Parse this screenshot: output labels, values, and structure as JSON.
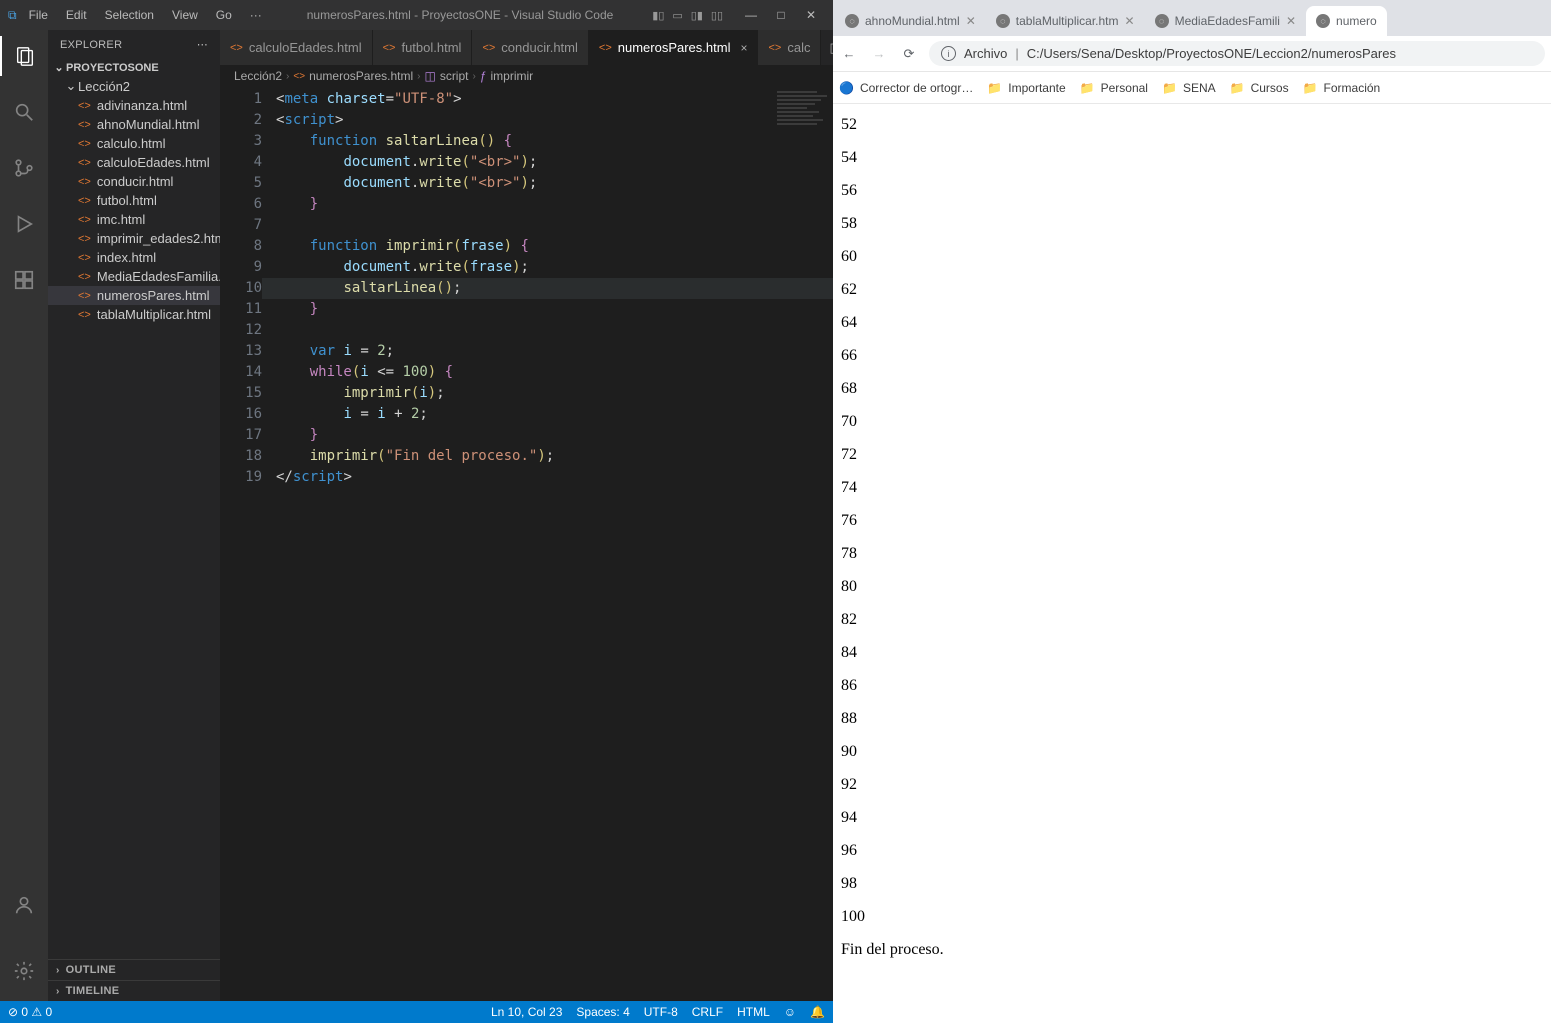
{
  "vscode": {
    "menus": [
      "File",
      "Edit",
      "Selection",
      "View",
      "Go",
      "···"
    ],
    "title": "numerosPares.html - ProyectosONE - Visual Studio Code",
    "explorer": {
      "title": "EXPLORER",
      "project": "PROYECTOSONE",
      "folder": "Lección2",
      "files": [
        "adivinanza.html",
        "ahnoMundial.html",
        "calculo.html",
        "calculoEdades.html",
        "conducir.html",
        "futbol.html",
        "imc.html",
        "imprimir_edades2.html",
        "index.html",
        "MediaEdadesFamilia.html",
        "numerosPares.html",
        "tablaMultiplicar.html"
      ],
      "activeFile": "numerosPares.html",
      "panels": [
        "OUTLINE",
        "TIMELINE"
      ]
    },
    "tabs": [
      {
        "name": "calculoEdades.html",
        "active": false
      },
      {
        "name": "futbol.html",
        "active": false
      },
      {
        "name": "conducir.html",
        "active": false
      },
      {
        "name": "numerosPares.html",
        "active": true,
        "close": "×"
      },
      {
        "name": "calc",
        "active": false,
        "truncated": true
      }
    ],
    "breadcrumbs": [
      "Lección2",
      "numerosPares.html",
      "script",
      "imprimir"
    ],
    "code": {
      "lines": [
        {
          "n": "1",
          "html": "<span class=\"op\">&lt;</span><span class=\"kw-struct\">meta</span> <span class=\"attr\">charset</span><span class=\"op\">=</span><span class=\"str\">\"UTF-8\"</span><span class=\"op\">&gt;</span>"
        },
        {
          "n": "2",
          "html": "<span class=\"op\">&lt;</span><span class=\"kw-struct\">script</span><span class=\"op\">&gt;</span>"
        },
        {
          "n": "3",
          "html": "    <span class=\"kw-struct\">function</span> <span class=\"fn\">saltarLinea</span><span class=\"brkt\">()</span> <span class=\"brkt2\">{</span>"
        },
        {
          "n": "4",
          "html": "        <span class=\"var\">document</span><span class=\"op\">.</span><span class=\"fn\">write</span><span class=\"brkt\">(</span><span class=\"str\">\"&lt;br&gt;\"</span><span class=\"brkt\">)</span><span class=\"op\">;</span>"
        },
        {
          "n": "5",
          "html": "        <span class=\"var\">document</span><span class=\"op\">.</span><span class=\"fn\">write</span><span class=\"brkt\">(</span><span class=\"str\">\"&lt;br&gt;\"</span><span class=\"brkt\">)</span><span class=\"op\">;</span>"
        },
        {
          "n": "6",
          "html": "    <span class=\"brkt2\">}</span>"
        },
        {
          "n": "7",
          "html": ""
        },
        {
          "n": "8",
          "html": "    <span class=\"kw-struct\">function</span> <span class=\"fn\">imprimir</span><span class=\"brkt\">(</span><span class=\"var\">frase</span><span class=\"brkt\">)</span> <span class=\"brkt2\">{</span>"
        },
        {
          "n": "9",
          "html": "        <span class=\"var\">document</span><span class=\"op\">.</span><span class=\"fn\">write</span><span class=\"brkt\">(</span><span class=\"var\">frase</span><span class=\"brkt\">)</span><span class=\"op\">;</span>"
        },
        {
          "n": "10",
          "html": "        <span class=\"fn\">saltarLinea</span><span class=\"brkt\">()</span><span class=\"op\">;</span>",
          "hl": true
        },
        {
          "n": "11",
          "html": "    <span class=\"brkt2\">}</span>"
        },
        {
          "n": "12",
          "html": ""
        },
        {
          "n": "13",
          "html": "    <span class=\"kw-struct\">var</span> <span class=\"var\">i</span> <span class=\"op\">=</span> <span class=\"num\">2</span><span class=\"op\">;</span>"
        },
        {
          "n": "14",
          "html": "    <span class=\"kw-pink\">while</span><span class=\"brkt\">(</span><span class=\"var\">i</span> <span class=\"op\">&lt;=</span> <span class=\"num\">100</span><span class=\"brkt\">)</span> <span class=\"brkt2\">{</span>"
        },
        {
          "n": "15",
          "html": "        <span class=\"fn\">imprimir</span><span class=\"brkt\">(</span><span class=\"var\">i</span><span class=\"brkt\">)</span><span class=\"op\">;</span>"
        },
        {
          "n": "16",
          "html": "        <span class=\"var\">i</span> <span class=\"op\">=</span> <span class=\"var\">i</span> <span class=\"op\">+</span> <span class=\"num\">2</span><span class=\"op\">;</span>"
        },
        {
          "n": "17",
          "html": "    <span class=\"brkt2\">}</span>"
        },
        {
          "n": "18",
          "html": "    <span class=\"fn\">imprimir</span><span class=\"brkt\">(</span><span class=\"str\">\"Fin del proceso.\"</span><span class=\"brkt\">)</span><span class=\"op\">;</span>"
        },
        {
          "n": "19",
          "html": "<span class=\"op\">&lt;/</span><span class=\"kw-struct\">script</span><span class=\"op\">&gt;</span>"
        }
      ]
    },
    "status": {
      "left": "⊘ 0 ⚠ 0",
      "right": [
        "Ln 10, Col 23",
        "Spaces: 4",
        "UTF-8",
        "CRLF",
        "HTML",
        "☺",
        "🔔"
      ]
    }
  },
  "chrome": {
    "tabs": [
      {
        "name": "ahnoMundial.html",
        "active": false
      },
      {
        "name": "tablaMultiplicar.htm",
        "active": false
      },
      {
        "name": "MediaEdadesFamili",
        "active": false
      },
      {
        "name": "numero",
        "active": true
      }
    ],
    "address": {
      "label": "Archivo",
      "path": "C:/Users/Sena/Desktop/ProyectosONE/Leccion2/numerosPares"
    },
    "bookmarks": [
      {
        "name": "Corrector de ortogr…",
        "icon": "s"
      },
      {
        "name": "Importante",
        "icon": "f"
      },
      {
        "name": "Personal",
        "icon": "f"
      },
      {
        "name": "SENA",
        "icon": "f"
      },
      {
        "name": "Cursos",
        "icon": "f"
      },
      {
        "name": "Formación",
        "icon": "f"
      }
    ],
    "output": [
      "52",
      "54",
      "56",
      "58",
      "60",
      "62",
      "64",
      "66",
      "68",
      "70",
      "72",
      "74",
      "76",
      "78",
      "80",
      "82",
      "84",
      "86",
      "88",
      "90",
      "92",
      "94",
      "96",
      "98",
      "100",
      "Fin del proceso."
    ]
  }
}
